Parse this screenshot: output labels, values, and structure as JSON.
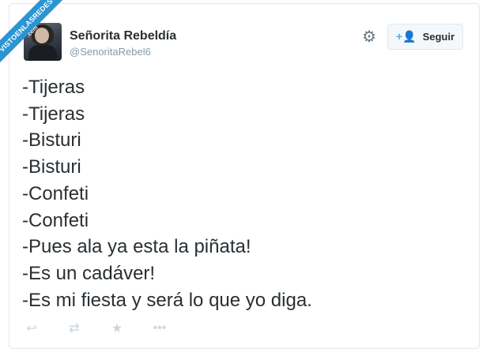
{
  "watermark": {
    "line1": "VISTOENLASREDES",
    "line2": ".com"
  },
  "author": {
    "name": "Señorita Rebeldía",
    "handle": "@SenoritaRebel6"
  },
  "follow_button": {
    "label": "Seguir"
  },
  "icons": {
    "settings": "gear-icon",
    "follow": "add-user-icon",
    "reply": "reply-icon",
    "retweet": "retweet-icon",
    "favorite": "star-icon",
    "more": "more-icon"
  },
  "colors": {
    "accent": "#55acee",
    "watermark": "#2b95d1",
    "text": "#292f33",
    "muted": "#8899a6"
  },
  "tweet": {
    "lines": [
      "-Tijeras",
      "-Tijeras",
      "-Bisturi",
      "-Bisturi",
      "-Confeti",
      "-Confeti",
      "-Pues ala ya esta la piñata!",
      "-Es un cadáver!",
      "-Es mi fiesta y será lo que yo diga."
    ]
  }
}
